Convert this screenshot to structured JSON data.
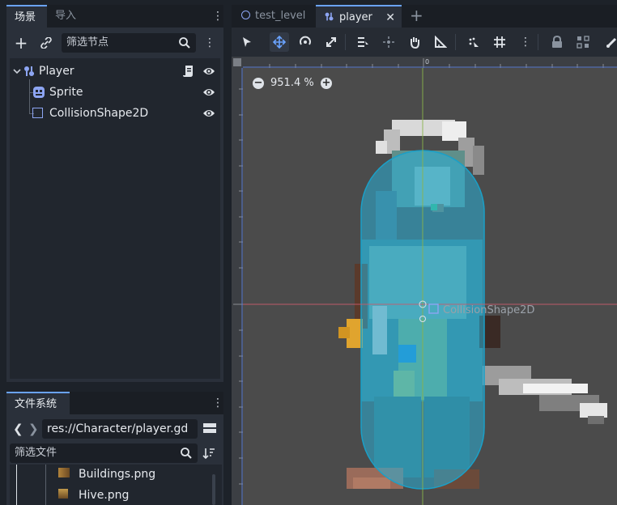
{
  "scene_dock": {
    "tabs": [
      "场景",
      "导入"
    ],
    "filter_placeholder": "筛选节点",
    "nodes": [
      {
        "label": "Player",
        "icon": "node2d-icon"
      },
      {
        "label": "Sprite",
        "icon": "sprite-icon"
      },
      {
        "label": "CollisionShape2D",
        "icon": "collision-shape-icon"
      }
    ]
  },
  "filesystem_dock": {
    "tab": "文件系统",
    "path": "res://Character/player.gd",
    "filter_placeholder": "筛选文件",
    "files": [
      "Buildings.png",
      "Hive.png"
    ]
  },
  "editor": {
    "tabs": [
      {
        "label": "test_level",
        "icon": "scene-circle-icon"
      },
      {
        "label": "player",
        "icon": "node2d-icon"
      }
    ],
    "zoom": "951.4 %",
    "ruler_zero": "0",
    "selected_node_label": "CollisionShape2D"
  },
  "colors": {
    "accent": "#6aa3ff",
    "panel": "#21262e",
    "viewport_bg": "#4b4b4b",
    "collision": "#2ab0d8"
  }
}
